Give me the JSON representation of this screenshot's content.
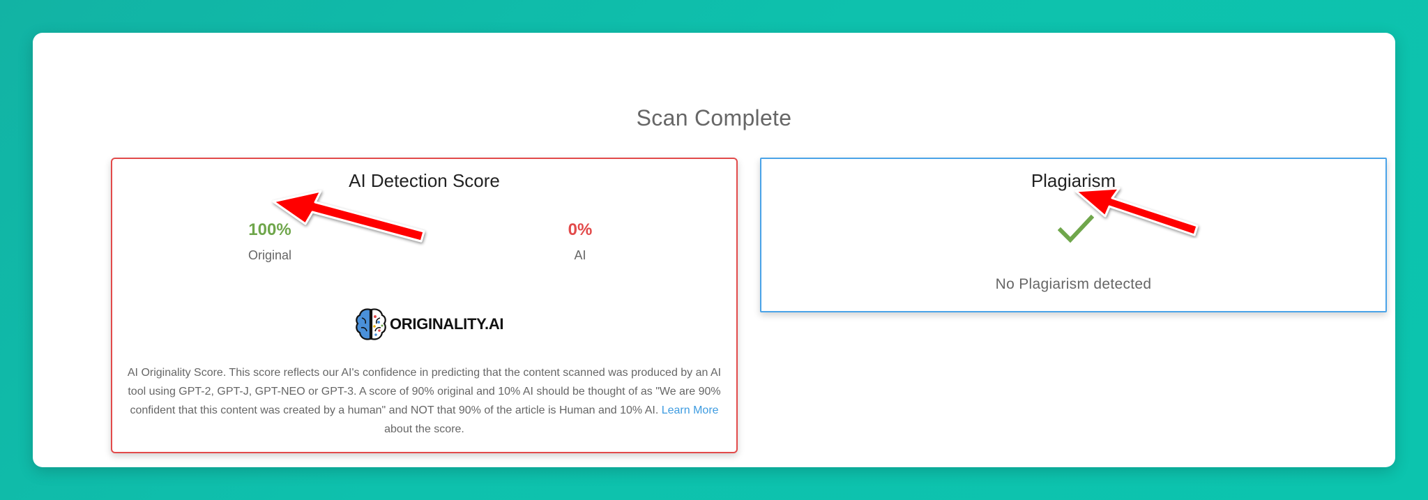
{
  "header": {
    "title": "Scan Complete"
  },
  "ai_card": {
    "title": "AI Detection Score",
    "original_value": "100%",
    "original_label": "Original",
    "ai_value": "0%",
    "ai_label": "AI",
    "logo_text": "ORIGINALITY.AI",
    "description_text": "AI Originality Score. This score reflects our AI's confidence in predicting that the content scanned was produced by an AI tool using GPT-2, GPT-J, GPT-NEO or GPT-3. A score of 90% original and 10% AI should be thought of as \"We are 90% confident that this content was created by a human\" and NOT that 90% of the article is Human and 10% AI.",
    "learn_more": "Learn More",
    "description_suffix": "about the score.",
    "colors": {
      "border": "#e24a4a",
      "original": "#6fa64b",
      "ai": "#e24a4a"
    }
  },
  "plagiarism_card": {
    "title": "Plagiarism",
    "status": "No Plagiarism detected",
    "icon": "checkmark-icon",
    "colors": {
      "border": "#4aa3e8",
      "check": "#6fa64b"
    }
  },
  "annotations": {
    "arrow_color": "#ff0000"
  }
}
